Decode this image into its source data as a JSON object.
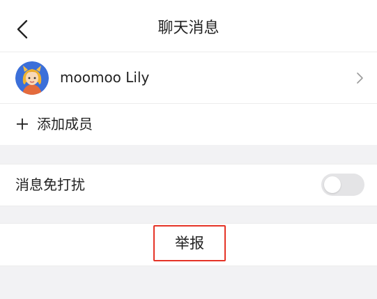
{
  "header": {
    "title": "聊天消息",
    "back_icon": "chevron-left-icon"
  },
  "member": {
    "name": "moomoo Lily",
    "avatar_icon": "avatar-cartoon-girl",
    "chevron_icon": "chevron-right-icon"
  },
  "add_member": {
    "icon": "plus-icon",
    "label": "添加成员"
  },
  "mute": {
    "label": "消息免打扰",
    "enabled": false
  },
  "report": {
    "label": "举报",
    "highlight_color": "#e53326"
  },
  "colors": {
    "background": "#f2f2f4",
    "surface": "#ffffff",
    "toggle_off": "#e4e4e6"
  }
}
